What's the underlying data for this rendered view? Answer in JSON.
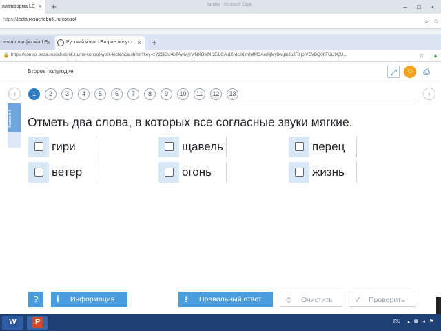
{
  "outer_browser": {
    "tab_title": "платформа LE",
    "tab_close": "×",
    "new_tab": "+",
    "window_title": "Yandex · Microsoft Edge",
    "minimize": "–",
    "maximize": "□",
    "close": "×",
    "url_prefix": "https://",
    "url_main": "lecta.rosuchebnik.ru/control"
  },
  "inner_browser": {
    "tabs": [
      {
        "label": "нная платформа LE"
      },
      {
        "label": "Русский язык · Второе полуго..."
      }
    ],
    "tab_close": "×",
    "new_tab": "+",
    "lock": "🔒",
    "url": "https://control.lecta.rosuchebnik.ru/ms-control-work-lecta/sca.shtml?key=zY28lOU4bTAwMjYwNXOwMDEiLCAidXNlciI6Imh4MDAwNjMyIiwgInJb2RlIjoiVEVBQ0hFUiJ9QU...",
    "url_host": "control.lecta.rosuchebnik.ru",
    "star": "☆"
  },
  "page": {
    "header_title": "Второе полугодие",
    "prev_arrow": "‹",
    "next_arrow": "›",
    "tasks": [
      "1",
      "2",
      "3",
      "4",
      "5",
      "6",
      "7",
      "8",
      "9",
      "10",
      "11",
      "12",
      "13"
    ],
    "active_task": "1",
    "variant_label": "Вариант 1",
    "question": "Отметь два слова, в которых все согласные звуки мягкие.",
    "options": [
      "гири",
      "щавель",
      "перец",
      "ветер",
      "огонь",
      "жизнь"
    ]
  },
  "toolbar": {
    "help": "?",
    "info_icon": "i",
    "info": "Информация",
    "answer": "Правильный ответ",
    "clear": "Очистить",
    "check": "Проверить"
  },
  "taskbar": {
    "word": "W",
    "ppt": "P",
    "lang": "RU"
  },
  "colors": {
    "accent": "#4a9ee0",
    "active_task": "#2e7dc4",
    "option_box": "#d8e7f5",
    "variant_strip": "#6fa6de",
    "taskbar": "#1e3f73"
  }
}
